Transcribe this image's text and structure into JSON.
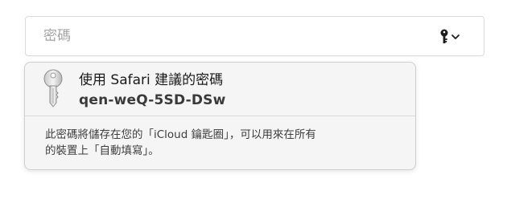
{
  "password_field": {
    "placeholder": "密碼",
    "key_icon": "key-icon",
    "dropdown_icon": "chevron-down-icon"
  },
  "suggestion_popover": {
    "icon": "keychain-key-icon",
    "title": "使用 Safari 建議的密碼",
    "suggested_password": "qen-weQ-5SD-DSw",
    "footnote_line1": "此密碼將儲存在您的「iCloud 鑰匙圈」，可以用來在所有",
    "footnote_line2": "的裝置上「自動填寫」。"
  },
  "colors": {
    "placeholder_text": "#a4a4a4",
    "popover_background": "#f5f5f5",
    "field_border": "#dadada"
  }
}
